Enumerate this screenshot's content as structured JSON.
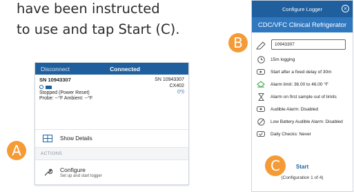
{
  "instructions": {
    "line1": "have been instructed",
    "line2": "to use and tap Start (C)."
  },
  "badges": {
    "a": "A",
    "b": "B",
    "c": "C"
  },
  "left_screen": {
    "disconnect": "Disconnect",
    "status": "Connected",
    "serial": "SN 10943307",
    "serial_right": "SN 10943307",
    "model": "CX402",
    "state": "Stopped (Power Reset)",
    "probe": "Probe: --°F Ambient: --°F",
    "show_details": "Show Details",
    "actions_header": "ACTIONS",
    "configure_label": "Configure",
    "configure_sub": "Set up and start logger"
  },
  "right_screen": {
    "title": "Configure Logger",
    "banner": "CDC/VFC Clinical Refrigerator",
    "name_value": "10943307",
    "options": [
      "15m logging",
      "Start after a fixed delay of 30m",
      "Alarm limit: 36.00 to 46.00 °F",
      "Alarm on first sample out of limits",
      "Audible Alarm: Disabled",
      "Low Battery Audible Alarm: Disabled",
      "Daily Checks: Never"
    ],
    "start": "Start",
    "config_note": "(Configuration 1 of 4)"
  },
  "colors": {
    "primary": "#1f5f9e",
    "banner": "#2f78bf",
    "badge": "#f59b36"
  }
}
